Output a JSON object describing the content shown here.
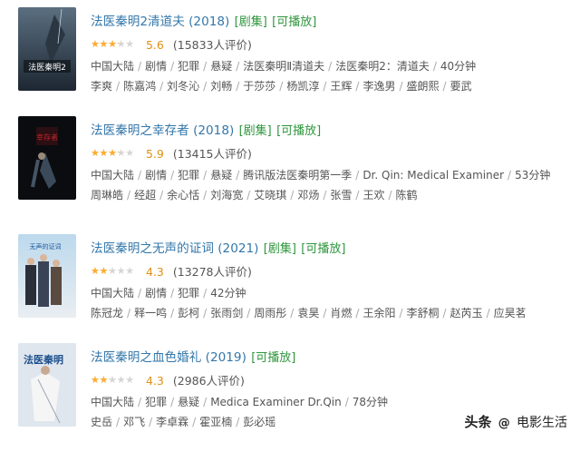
{
  "items": [
    {
      "title": "法医秦明2清道夫 (2018)",
      "tags": [
        "[剧集]",
        "[可播放]"
      ],
      "stars": 3,
      "score": "5.6",
      "votes": "(15833人评价)",
      "meta": [
        "中国大陆",
        "剧情",
        "犯罪",
        "悬疑",
        "法医秦明Ⅱ清道夫",
        "法医秦明2：清道夫",
        "40分钟"
      ],
      "cast": [
        "李爽",
        "陈嘉鸿",
        "刘冬沁",
        "刘畅",
        "于莎莎",
        "杨凯淳",
        "王辉",
        "李逸男",
        "盛朗熙",
        "要武"
      ],
      "poster_text": "法医秦明2"
    },
    {
      "title": "法医秦明之幸存者 (2018)",
      "tags": [
        "[剧集]",
        "[可播放]"
      ],
      "stars": 3,
      "score": "5.9",
      "votes": "(13415人评价)",
      "meta": [
        "中国大陆",
        "剧情",
        "犯罪",
        "悬疑",
        "腾讯版法医秦明第一季",
        "Dr. Qin: Medical Examiner",
        "53分钟"
      ],
      "cast": [
        "周琳皓",
        "经超",
        "余心恬",
        "刘海宽",
        "艾晓琪",
        "邓炀",
        "张雪",
        "王欢",
        "陈鹤"
      ],
      "poster_text": "幸存者"
    },
    {
      "title": "法医秦明之无声的证词 (2021)",
      "tags": [
        "[剧集]",
        "[可播放]"
      ],
      "stars": 2,
      "score": "4.3",
      "votes": "(13278人评价)",
      "meta": [
        "中国大陆",
        "剧情",
        "犯罪",
        "42分钟"
      ],
      "cast": [
        "陈冠龙",
        "释一鸣",
        "彭柯",
        "张雨剑",
        "周雨彤",
        "袁昊",
        "肖燃",
        "王余阳",
        "李舒桐",
        "赵芮玉",
        "应昊茗"
      ],
      "poster_text": "无声的证词"
    },
    {
      "title": "法医秦明之血色婚礼 (2019)",
      "tags": [
        "[可播放]"
      ],
      "stars": 2,
      "score": "4.3",
      "votes": "(2986人评价)",
      "meta": [
        "中国大陆",
        "犯罪",
        "悬疑",
        "Medica Examiner Dr.Qin",
        "78分钟"
      ],
      "cast": [
        "史岳",
        "邓飞",
        "李卓霖",
        "霍亚楠",
        "彭必瑶"
      ],
      "poster_text": "法医秦明"
    }
  ],
  "watermark": {
    "prefix": "头条",
    "brand": "电影生活"
  },
  "colors": {
    "link": "#3377aa",
    "tag": "#2e963d",
    "star": "#ffac2d",
    "score": "#e09015"
  }
}
